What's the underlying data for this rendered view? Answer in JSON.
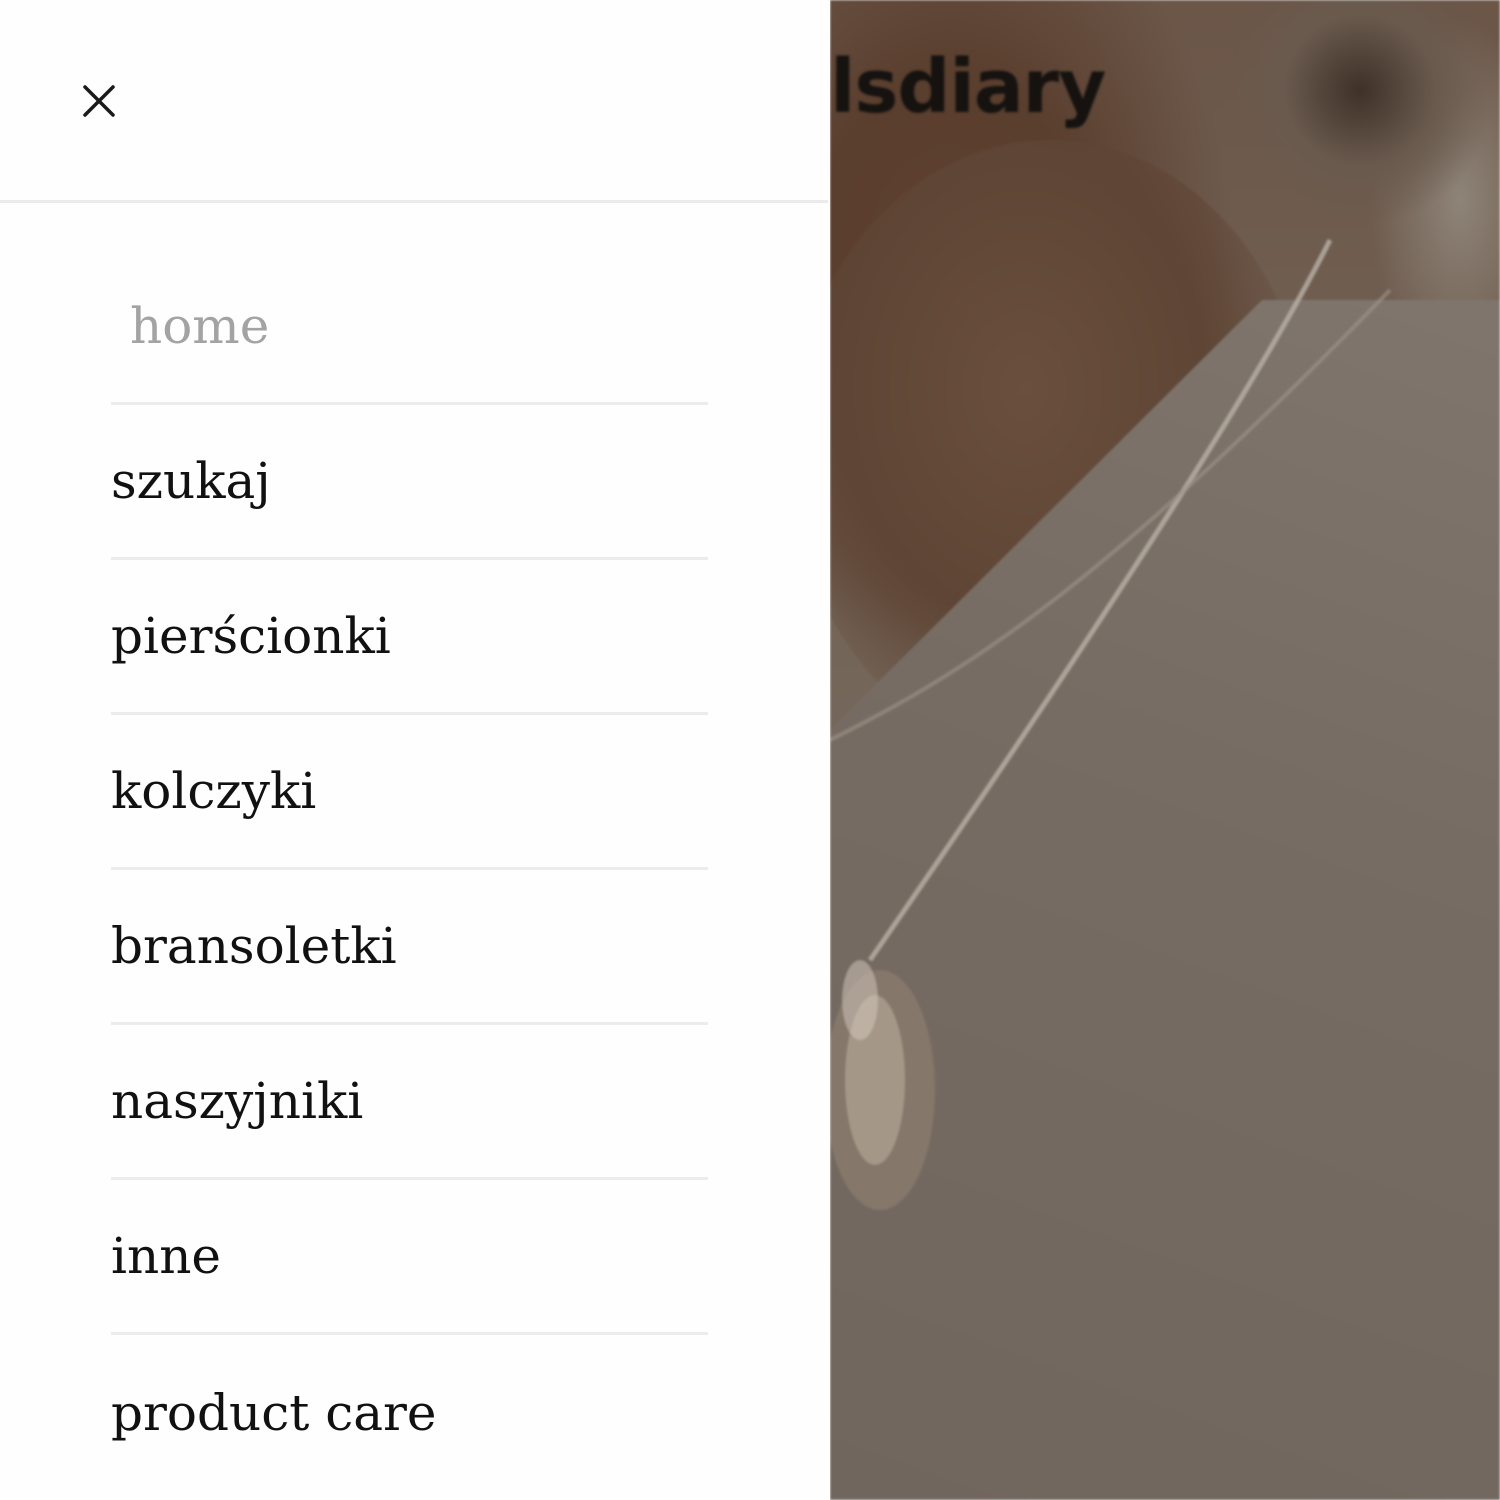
{
  "drawer": {
    "close_icon": "close-icon",
    "items": [
      {
        "label": "home",
        "active": true
      },
      {
        "label": "szukaj",
        "active": false
      },
      {
        "label": "pierścionki",
        "active": false
      },
      {
        "label": "kolczyki",
        "active": false
      },
      {
        "label": "bransoletki",
        "active": false
      },
      {
        "label": "naszyjniki",
        "active": false
      },
      {
        "label": "inne",
        "active": false
      },
      {
        "label": "product care",
        "active": false
      }
    ]
  },
  "background": {
    "visible_text": "lsdiary"
  },
  "colors": {
    "drawer_bg": "#fefefe",
    "active_item": "#a3a3a3",
    "item_text": "#111111",
    "divider": "#ececec"
  }
}
